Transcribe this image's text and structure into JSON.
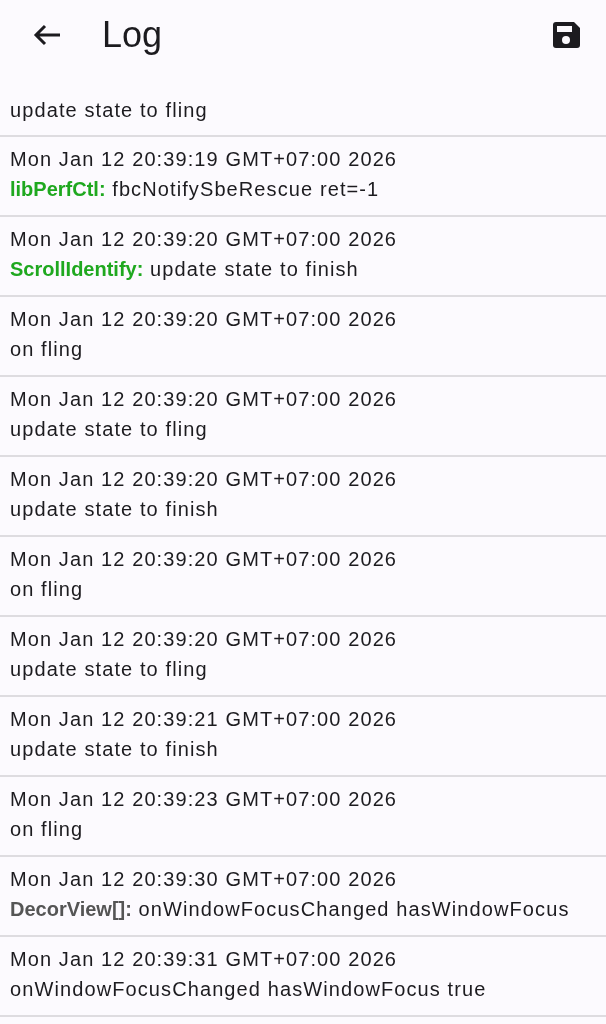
{
  "app_bar": {
    "title": "Log"
  },
  "entries": [
    {
      "message": "update state to fling"
    },
    {
      "time": "Mon Jan 12 20:39:19 GMT+07:00 2026",
      "tag": "libPerfCtl:",
      "color": "#1fa81f",
      "message": "fbcNotifySbeRescue ret=-1"
    },
    {
      "time": "Mon Jan 12 20:39:20 GMT+07:00 2026",
      "tag": "ScrollIdentify:",
      "color": "#1fa81f",
      "message": "update state to finish"
    },
    {
      "time": "Mon Jan 12 20:39:20 GMT+07:00 2026",
      "message": "on fling"
    },
    {
      "time": "Mon Jan 12 20:39:20 GMT+07:00 2026",
      "message": "update state to fling"
    },
    {
      "time": "Mon Jan 12 20:39:20 GMT+07:00 2026",
      "message": "update state to finish"
    },
    {
      "time": "Mon Jan 12 20:39:20 GMT+07:00 2026",
      "message": "on fling"
    },
    {
      "time": "Mon Jan 12 20:39:20 GMT+07:00 2026",
      "message": "update state to fling"
    },
    {
      "time": "Mon Jan 12 20:39:21 GMT+07:00 2026",
      "message": "update state to finish"
    },
    {
      "time": "Mon Jan 12 20:39:23 GMT+07:00 2026",
      "message": "on fling"
    },
    {
      "time": "Mon Jan 12 20:39:30 GMT+07:00 2026",
      "tag": "DecorView[]:",
      "color": "#555555",
      "message": "onWindowFocusChanged hasWindowFocus"
    },
    {
      "time": "Mon Jan 12 20:39:31 GMT+07:00 2026",
      "message": "onWindowFocusChanged hasWindowFocus true"
    }
  ]
}
